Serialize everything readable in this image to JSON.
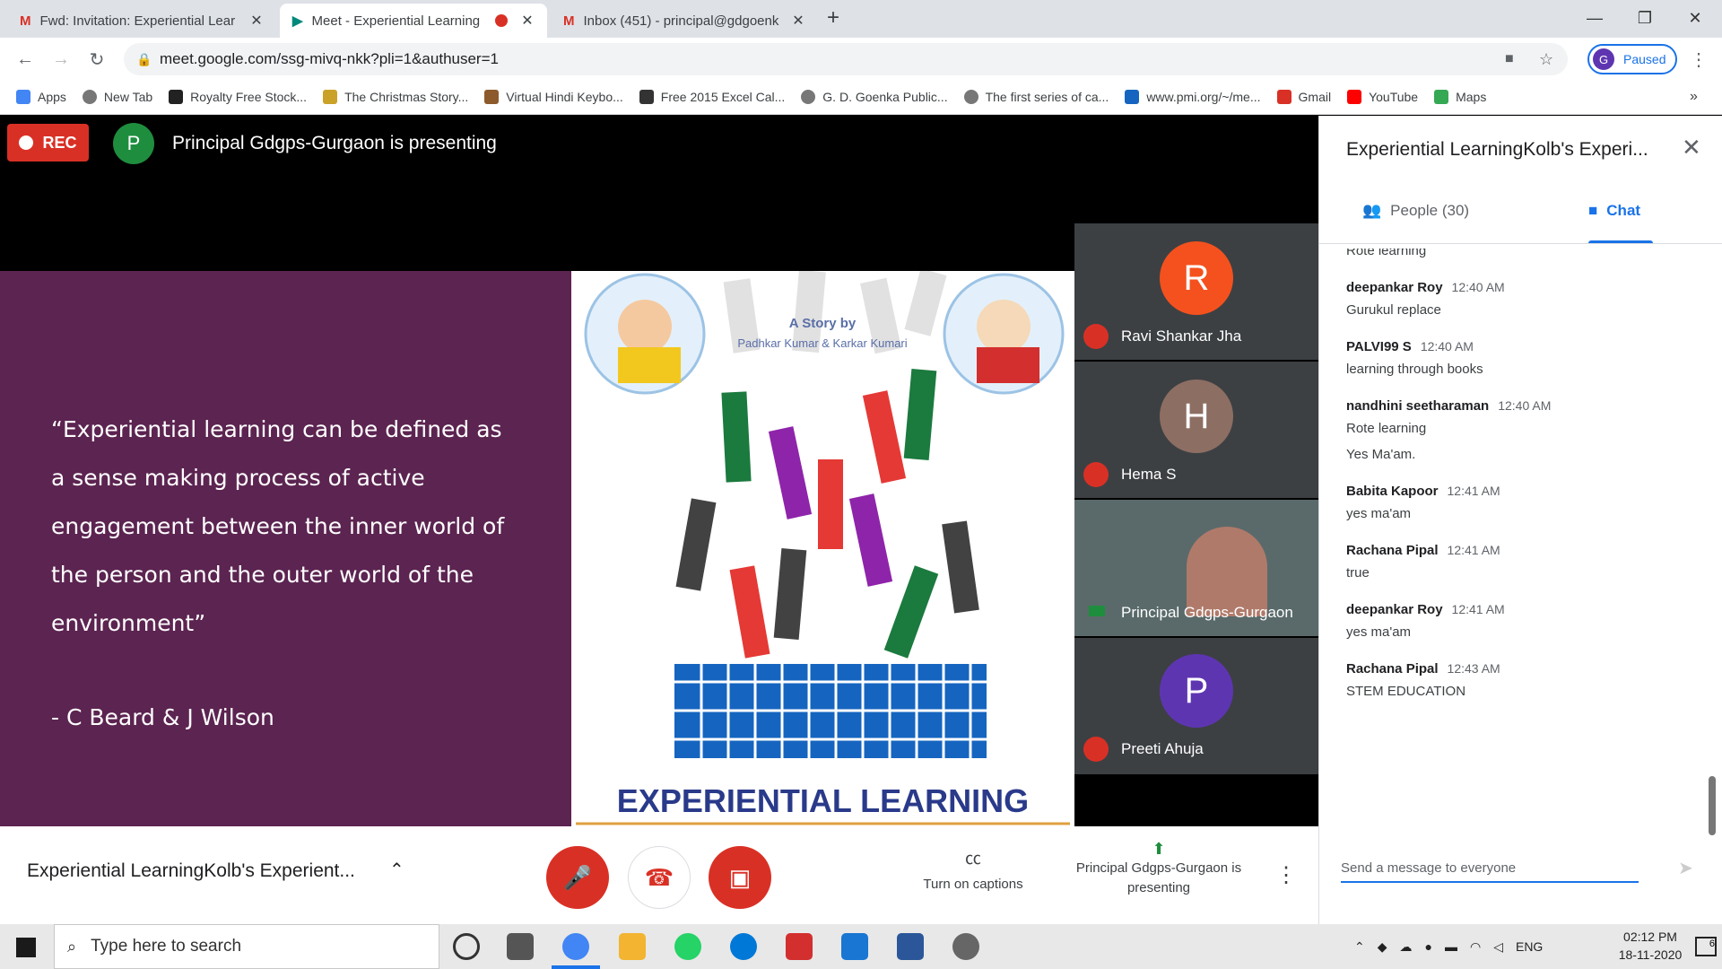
{
  "browser": {
    "tabs": [
      {
        "title": "Fwd: Invitation: Experiential Lear"
      },
      {
        "title": "Meet - Experiential Learning"
      },
      {
        "title": "Inbox (451) - principal@gdgoenk"
      }
    ],
    "url": "meet.google.com/ssg-mivq-nkk?pli=1&authuser=1",
    "profile_label": "Paused",
    "profile_initial": "G",
    "bookmarks": [
      "Apps",
      "New Tab",
      "Royalty Free Stock...",
      "The Christmas Story...",
      "Virtual Hindi Keybo...",
      "Free 2015 Excel Cal...",
      "G. D. Goenka Public...",
      "The first series of ca...",
      "www.pmi.org/~/me...",
      "Gmail",
      "YouTube",
      "Maps"
    ]
  },
  "meet": {
    "rec_label": "REC",
    "presenter_initial": "P",
    "presenter_banner": "Principal Gdgps-Gurgaon is presenting",
    "slide": {
      "quote": "“Experiential learning can be defined as a sense making process of active engagement between the inner world of the person and the outer world of the environment”",
      "author": "- C Beard & J Wilson",
      "story_title": "A Story by",
      "story_authors": "Padhkar Kumar & Karkar Kumari",
      "title": "EXPERIENTIAL LEARNING"
    },
    "participants": [
      {
        "initial": "R",
        "name": "Ravi Shankar Jha",
        "color": "#f4511e"
      },
      {
        "initial": "H",
        "name": "Hema S",
        "color": "#8d6e63"
      },
      {
        "initial": "",
        "name": "Principal Gdgps-Gurgaon",
        "color": "#5a6a6a"
      },
      {
        "initial": "P",
        "name": "Preeti Ahuja",
        "color": "#5e35b1"
      }
    ],
    "meeting_title": "Experiential LearningKolb's Experient...",
    "captions_label": "Turn on captions",
    "presenting_label": "Principal Gdgps-Gurgaon is presenting",
    "panel": {
      "title": "Experiential LearningKolb's Experi...",
      "people_tab": "People (30)",
      "chat_tab": "Chat",
      "messages": [
        {
          "sender": "",
          "time": "",
          "text": "Rote learning"
        },
        {
          "sender": "deepankar Roy",
          "time": "12:40 AM",
          "text": "Gurukul replace"
        },
        {
          "sender": "PALVI99 S",
          "time": "12:40 AM",
          "text": "learning through books"
        },
        {
          "sender": "nandhini seetharaman",
          "time": "12:40 AM",
          "text": "Rote learning"
        },
        {
          "sender": "",
          "time": "",
          "text": "Yes Ma'am."
        },
        {
          "sender": "Babita Kapoor",
          "time": "12:41 AM",
          "text": "yes ma'am"
        },
        {
          "sender": "Rachana Pipal",
          "time": "12:41 AM",
          "text": "true"
        },
        {
          "sender": "deepankar Roy",
          "time": "12:41 AM",
          "text": "yes ma'am"
        },
        {
          "sender": "Rachana Pipal",
          "time": "12:43 AM",
          "text": "STEM EDUCATION"
        }
      ],
      "input_placeholder": "Send a message to everyone"
    }
  },
  "taskbar": {
    "search_placeholder": "Type here to search",
    "language": "ENG",
    "time": "02:12 PM",
    "date": "18-11-2020",
    "notification_count": "6"
  }
}
